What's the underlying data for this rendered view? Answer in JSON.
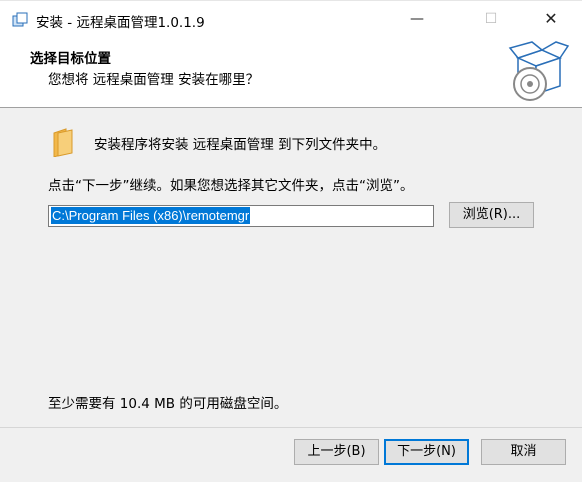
{
  "window": {
    "title": "安装 - 远程桌面管理1.0.1.9",
    "minimize_glyph": "—",
    "maximize_glyph": "☐",
    "close_glyph": "✕"
  },
  "header": {
    "title": "选择目标位置",
    "subtitle": "您想将 远程桌面管理 安装在哪里？",
    "graphic_icon": "setup-box-disc-icon"
  },
  "content": {
    "intro_text": "安装程序将安装 远程桌面管理 到下列文件夹中。",
    "instruction_text": "点击“下一步”继续。如果您想选择其它文件夹，点击“浏览”。",
    "folder_icon": "folder-icon",
    "path_value": "C:\\Program Files (x86)\\remotemgr",
    "browse_button_label": "浏览(R)...",
    "disk_space_text": "至少需要有 10.4 MB 的可用磁盘空间。"
  },
  "footer": {
    "back_button_label": "上一步(B)",
    "next_button_label": "下一步(N)",
    "cancel_button_label": "取消"
  },
  "colors": {
    "accent": "#0078d7",
    "background": "#f0f0f0",
    "header_background": "#ffffff",
    "folder": "#f5c566"
  }
}
